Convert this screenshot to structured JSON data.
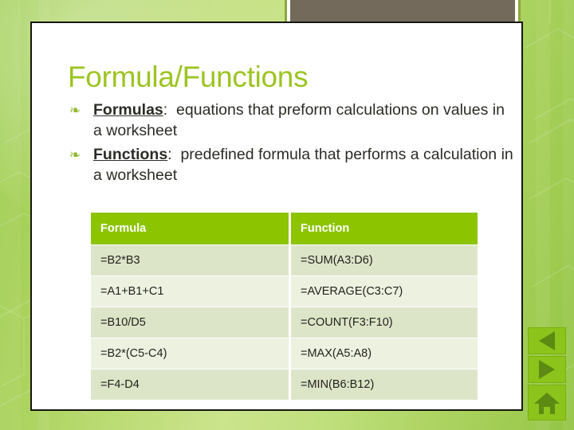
{
  "slide": {
    "title": "Formula/Functions",
    "bullets": [
      {
        "glyph": "❧",
        "glyph_name": "leaf-bullet-icon",
        "term": "Formulas",
        "separator": ":",
        "text": "equations that preform calculations on values in a worksheet"
      },
      {
        "glyph": "❧",
        "glyph_name": "leaf-bullet-icon",
        "term": "Functions",
        "separator": ":",
        "text": "predefined formula that performs a calculation in a worksheet"
      }
    ],
    "table": {
      "headers": [
        "Formula",
        "Function"
      ],
      "rows": [
        [
          "=B2*B3",
          "=SUM(A3:D6)"
        ],
        [
          "=A1+B1+C1",
          "=AVERAGE(C3:C7)"
        ],
        [
          "=B10/D5",
          "=COUNT(F3:F10)"
        ],
        [
          "=B2*(C5-C4)",
          "=MAX(A5:A8)"
        ],
        [
          "=F4-D4",
          "=MIN(B6:B12)"
        ]
      ]
    }
  },
  "navigation": {
    "back": {
      "label": "Previous slide",
      "icon": "triangle-left-icon"
    },
    "forward": {
      "label": "Next slide",
      "icon": "triangle-right-icon"
    },
    "home": {
      "label": "Home",
      "icon": "home-icon"
    }
  },
  "colors": {
    "background_green": "#9ccc4e",
    "title_green": "#9cc421",
    "table_header_green": "#8cc400",
    "table_row_dark": "#dde5c9",
    "table_row_light": "#edf1e0",
    "nav_button_green": "#8cc41b",
    "nav_icon_green": "#5d8a12",
    "header_image_gray": "#736a5c",
    "body_text": "#2c2c26"
  }
}
